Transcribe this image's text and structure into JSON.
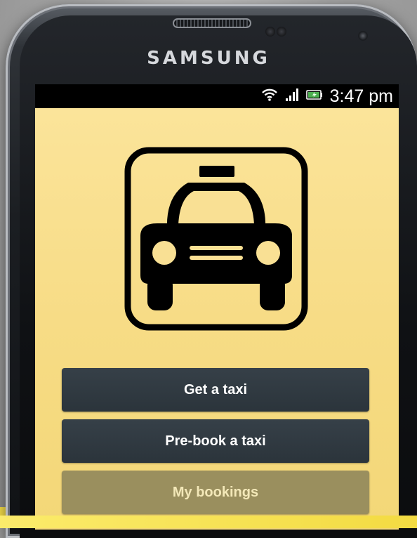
{
  "device": {
    "brand": "SAMSUNG"
  },
  "status_bar": {
    "time": "3:47 pm",
    "icons": [
      "wifi-icon",
      "signal-icon",
      "battery-icon"
    ]
  },
  "app": {
    "logo_icon": "taxi-icon",
    "buttons": {
      "get_taxi": "Get a taxi",
      "prebook_taxi": "Pre-book a taxi",
      "my_bookings": "My bookings"
    }
  },
  "colors": {
    "screen_bg": "#f7dc86",
    "button_dark": "#2f383f",
    "button_muted": "#9a8f5e",
    "logo": "#000000"
  }
}
